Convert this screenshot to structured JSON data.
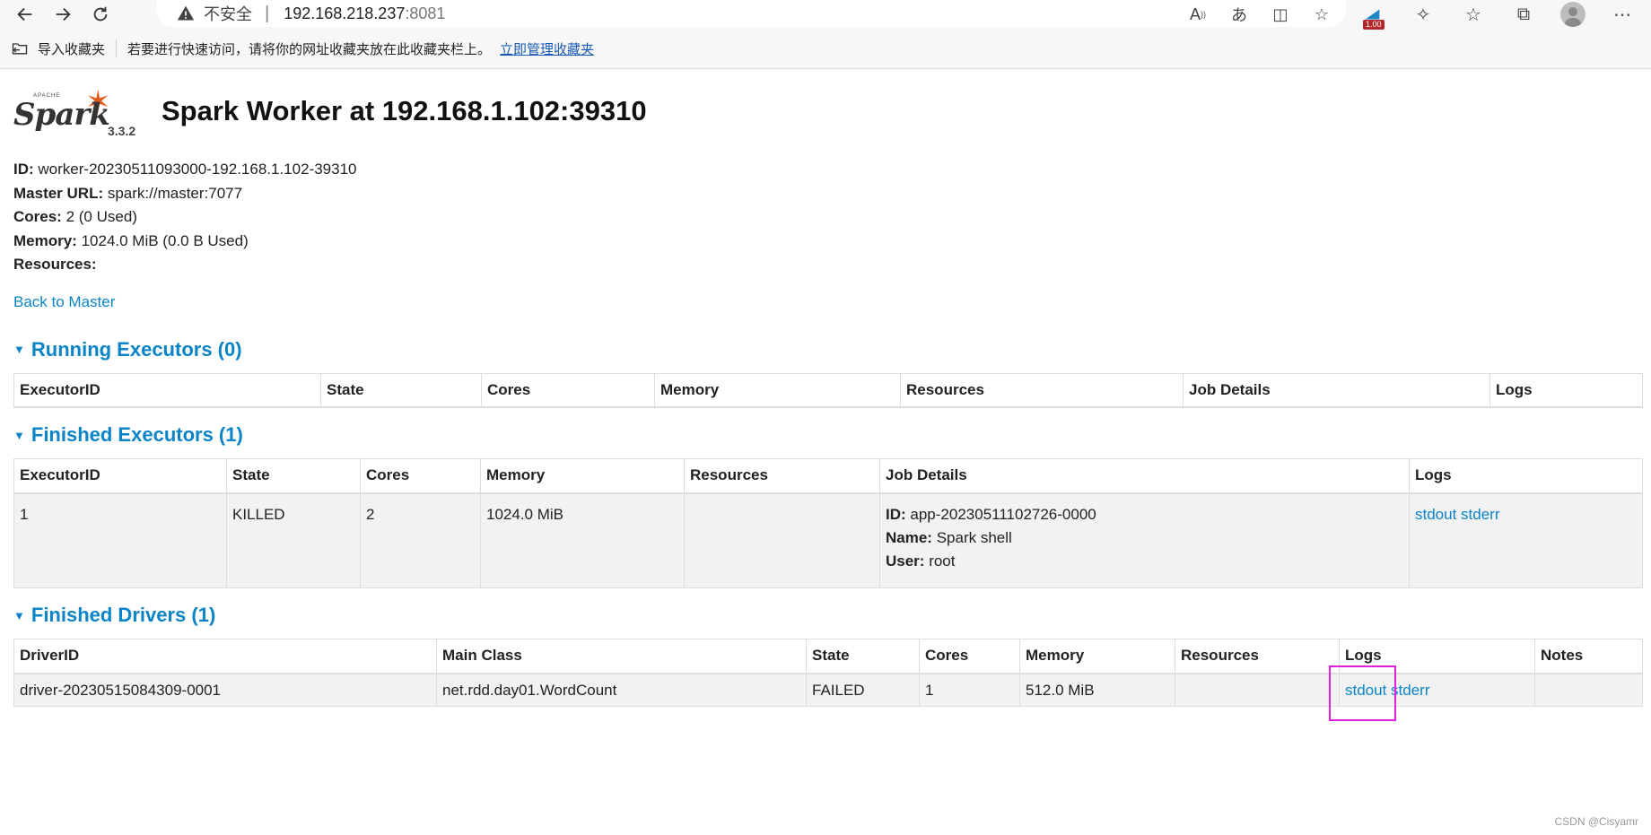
{
  "browser": {
    "security_label": "不安全",
    "address_host": "192.168.218.237",
    "address_port": ":8081",
    "extension_badge": "1.00"
  },
  "bookmarks_bar": {
    "import_label": "导入收藏夹",
    "tip": "若要进行快速访问，请将你的网址收藏夹放在此收藏夹栏上。",
    "manage_link": "立即管理收藏夹"
  },
  "page": {
    "logo_text": "Spark",
    "logo_apache": "APACHE",
    "version": "3.3.2",
    "title": "Spark Worker at 192.168.1.102:39310",
    "info": {
      "id_label": "ID:",
      "id_value": " worker-20230511093000-192.168.1.102-39310",
      "master_label": "Master URL:",
      "master_value": " spark://master:7077",
      "cores_label": "Cores:",
      "cores_value": " 2 (0 Used)",
      "memory_label": "Memory:",
      "memory_value": " 1024.0 MiB (0.0 B Used)",
      "resources_label": "Resources:"
    },
    "back_link": "Back to Master"
  },
  "running_executors": {
    "title": "Running Executors (0)",
    "headers": [
      "ExecutorID",
      "State",
      "Cores",
      "Memory",
      "Resources",
      "Job Details",
      "Logs"
    ]
  },
  "finished_executors": {
    "title": "Finished Executors (1)",
    "headers": [
      "ExecutorID",
      "State",
      "Cores",
      "Memory",
      "Resources",
      "Job Details",
      "Logs"
    ],
    "rows": [
      {
        "executor_id": "1",
        "state": "KILLED",
        "cores": "2",
        "memory": "1024.0 MiB",
        "resources": "",
        "job_id_label": "ID:",
        "job_id": " app-20230511102726-0000",
        "job_name_label": "Name:",
        "job_name": " Spark shell",
        "job_user_label": "User:",
        "job_user": " root",
        "log_stdout": "stdout",
        "log_stderr": "stderr"
      }
    ]
  },
  "finished_drivers": {
    "title": "Finished Drivers (1)",
    "headers": [
      "DriverID",
      "Main Class",
      "State",
      "Cores",
      "Memory",
      "Resources",
      "Logs",
      "Notes"
    ],
    "rows": [
      {
        "driver_id": "driver-20230515084309-0001",
        "main_class": "net.rdd.day01.WordCount",
        "state": "FAILED",
        "cores": "1",
        "memory": "512.0 MiB",
        "resources": "",
        "log_stdout": "stdout",
        "log_stderr": "stderr",
        "notes": ""
      }
    ]
  },
  "watermark": "CSDN @Cisyamr",
  "colors": {
    "link": "#0a84c7",
    "highlight": "#e11fe0",
    "spark_orange": "#e25a1c"
  }
}
